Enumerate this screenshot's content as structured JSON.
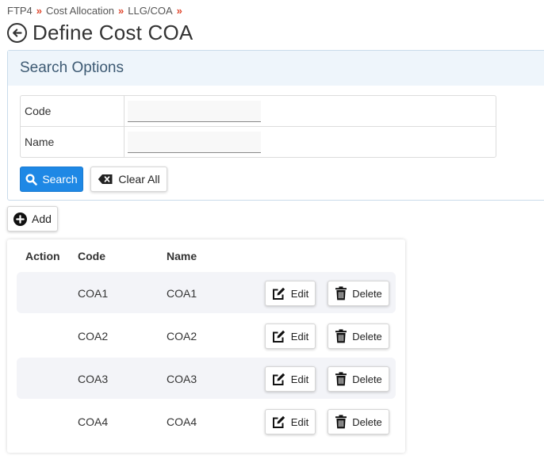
{
  "breadcrumb": [
    "FTP4",
    "Cost Allocation",
    "LLG/COA"
  ],
  "breadcrumb_separator": "»",
  "page_title": "Define Cost COA",
  "search_panel": {
    "title": "Search Options",
    "fields": {
      "code_label": "Code",
      "code_value": "",
      "name_label": "Name",
      "name_value": ""
    },
    "search_label": "Search",
    "clear_label": "Clear All"
  },
  "add_label": "Add",
  "grid": {
    "headers": {
      "action": "Action",
      "code": "Code",
      "name": "Name"
    },
    "rows": [
      {
        "code": "COA1",
        "name": "COA1"
      },
      {
        "code": "COA2",
        "name": "COA2"
      },
      {
        "code": "COA3",
        "name": "COA3"
      },
      {
        "code": "COA4",
        "name": "COA4"
      }
    ],
    "edit_label": "Edit",
    "delete_label": "Delete"
  },
  "colors": {
    "primary": "#1e88e5",
    "separator": "#e0452b",
    "panel_header_bg": "#eef5fb",
    "row_alt_bg": "#f3f4f8"
  },
  "icons": {
    "back": "arrow-left-circle-icon",
    "search": "magnifier-icon",
    "clear": "backspace-x-icon",
    "add": "plus-circle-icon",
    "edit": "pencil-square-icon",
    "delete": "trash-icon"
  }
}
